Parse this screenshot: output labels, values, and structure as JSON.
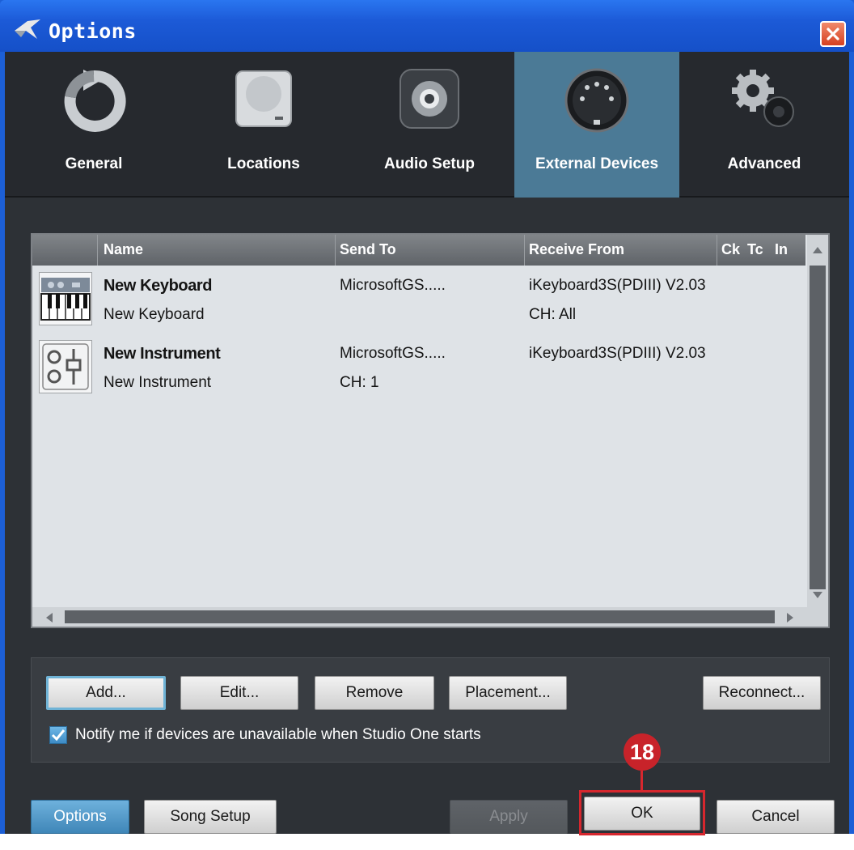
{
  "window": {
    "title": "Options"
  },
  "tabs": [
    {
      "label": "General",
      "icon": "refresh-icon"
    },
    {
      "label": "Locations",
      "icon": "drive-icon"
    },
    {
      "label": "Audio Setup",
      "icon": "speaker-icon"
    },
    {
      "label": "External Devices",
      "icon": "midi-connector-icon",
      "active": true
    },
    {
      "label": "Advanced",
      "icon": "gears-icon"
    }
  ],
  "table": {
    "columns": [
      "Name",
      "Send To",
      "Receive From",
      "Ck",
      "Tc",
      "In"
    ],
    "rows": [
      {
        "icon": "keyboard-icon",
        "name": "New Keyboard",
        "subname": "New Keyboard",
        "send_to": "MicrosoftGS.....",
        "send_sub": "",
        "receive_from": "iKeyboard3S(PDIII) V2.03",
        "receive_sub": "CH: All"
      },
      {
        "icon": "instrument-icon",
        "name": "New Instrument",
        "subname": "New Instrument",
        "send_to": "MicrosoftGS.....",
        "send_sub": "CH: 1",
        "receive_from": "iKeyboard3S(PDIII) V2.03",
        "receive_sub": ""
      }
    ]
  },
  "actions": {
    "add": "Add...",
    "edit": "Edit...",
    "remove": "Remove",
    "placement": "Placement...",
    "reconnect": "Reconnect...",
    "notify_label": "Notify me if devices are unavailable when Studio One starts",
    "notify_checked": true
  },
  "footer": {
    "options": "Options",
    "song_setup": "Song Setup",
    "apply": "Apply",
    "ok": "OK",
    "cancel": "Cancel"
  },
  "annotation": {
    "number": "18"
  },
  "colors": {
    "active_tab": "#4b7a96",
    "callout": "#d6272e",
    "titlebar": "#1c5ad7"
  }
}
